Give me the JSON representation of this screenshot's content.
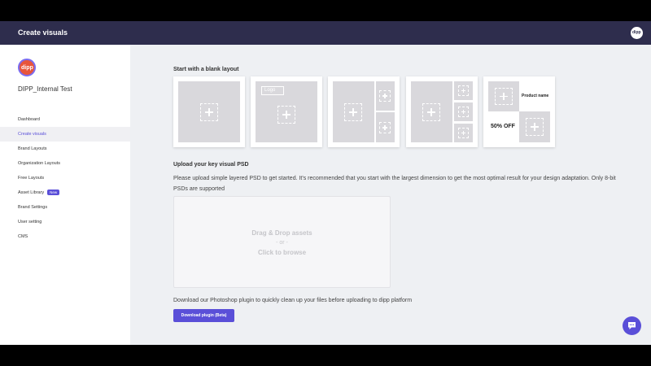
{
  "topbar": {
    "title": "Create visuals",
    "brand": "dipp"
  },
  "sidebar": {
    "logo_text": "dipp",
    "org_name": "DIPP_Internal Test",
    "items": [
      {
        "label": "Dashboard"
      },
      {
        "label": "Create visuals",
        "active": true
      },
      {
        "label": "Brand Layouts"
      },
      {
        "label": "Organization Layouts"
      },
      {
        "label": "Free Layouts"
      },
      {
        "label": "Asset Library",
        "badge": "New"
      },
      {
        "label": "Brand Settings"
      },
      {
        "label": "User setting"
      },
      {
        "label": "CMS"
      }
    ]
  },
  "blank_layouts": {
    "heading": "Start with a blank layout",
    "logo_label": "Logo",
    "product_name": "Product name",
    "discount": "50% OFF"
  },
  "upload": {
    "heading": "Upload your key visual PSD",
    "description": "Please upload simple layered PSD to get started. It's recommended that you start with the largest dimension to get the most optimal result for your design adaptation. Only 8-bit PSDs are supported",
    "drop_title": "Drag & Drop assets",
    "drop_or": "- or -",
    "drop_browse": "Click to browse"
  },
  "plugin": {
    "text": "Download our Photoshop plugin to quickly clean up your files before uploading to dipp platform",
    "button_label": "Download plugin (Beta)"
  },
  "colors": {
    "topbar": "#2e2d4d",
    "accent": "#5a4fd8",
    "background": "#eef0f3"
  }
}
